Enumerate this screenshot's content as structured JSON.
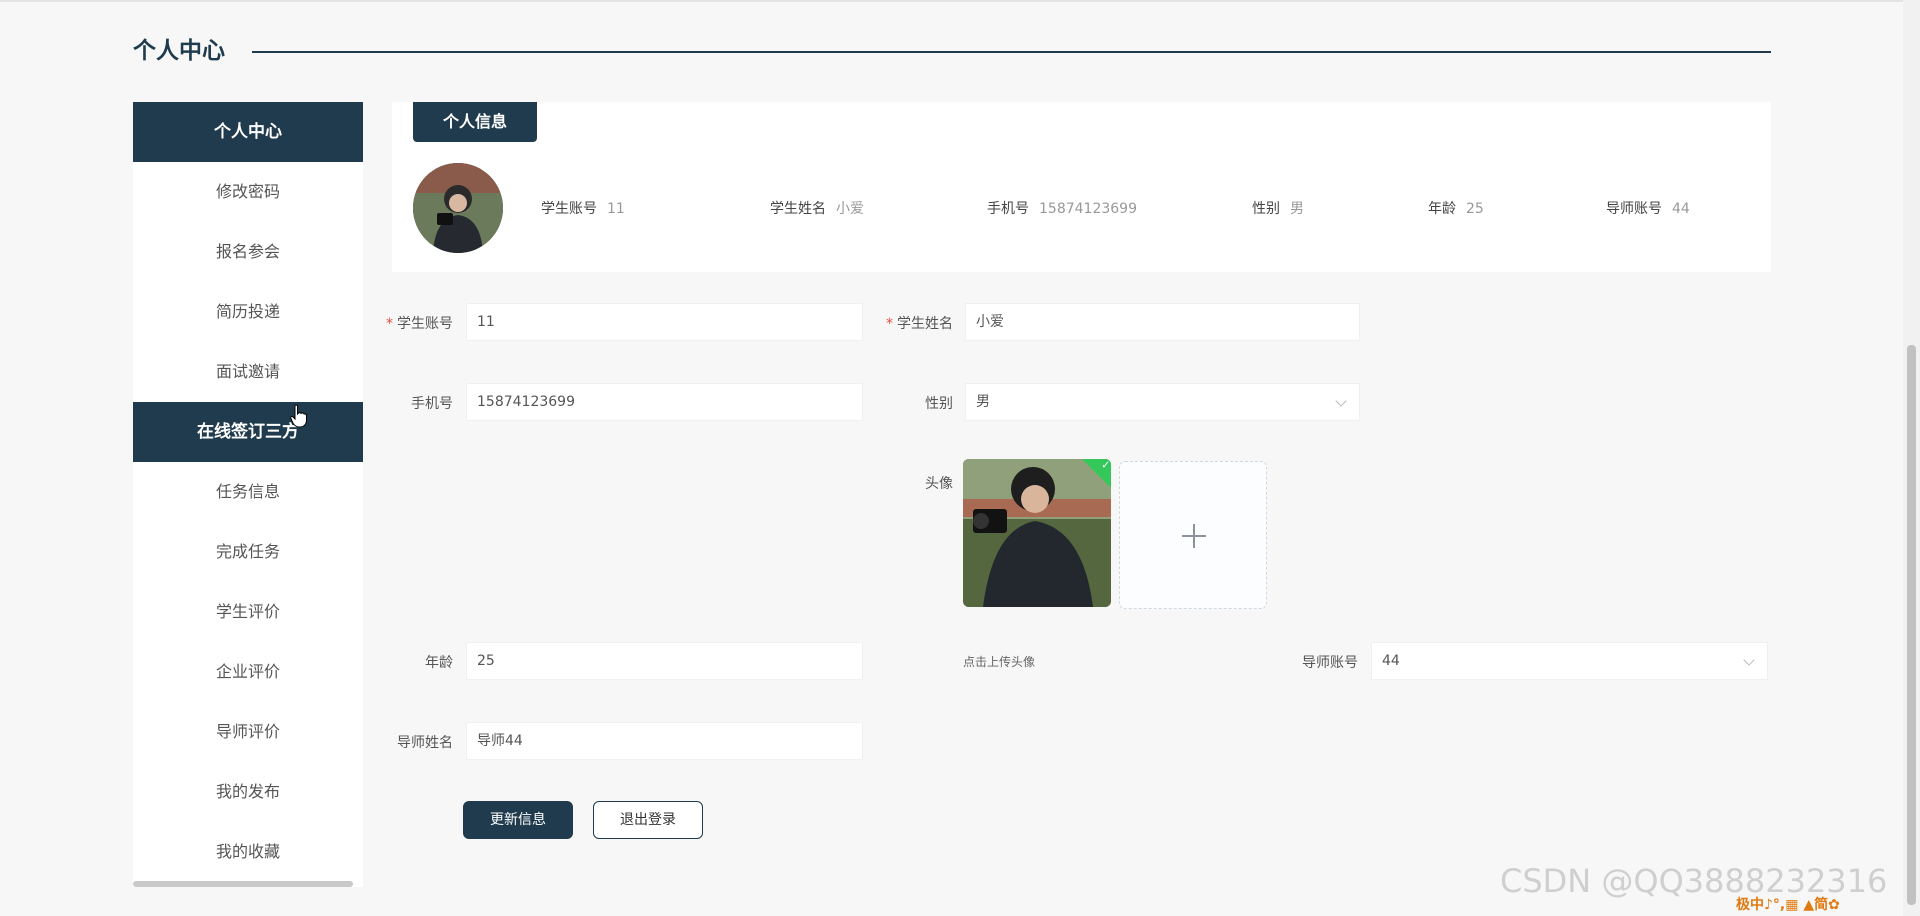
{
  "page": {
    "title": "个人中心"
  },
  "sidebar": {
    "items": [
      {
        "label": "个人中心"
      },
      {
        "label": "修改密码"
      },
      {
        "label": "报名参会"
      },
      {
        "label": "简历投递"
      },
      {
        "label": "面试邀请"
      },
      {
        "label": "在线签订三方"
      },
      {
        "label": "任务信息"
      },
      {
        "label": "完成任务"
      },
      {
        "label": "学生评价"
      },
      {
        "label": "企业评价"
      },
      {
        "label": "导师评价"
      },
      {
        "label": "我的发布"
      },
      {
        "label": "我的收藏"
      }
    ]
  },
  "card": {
    "tab_label": "个人信息",
    "summary": [
      {
        "label": "学生账号",
        "value": "11"
      },
      {
        "label": "学生姓名",
        "value": "小爱"
      },
      {
        "label": "手机号",
        "value": "15874123699"
      },
      {
        "label": "性别",
        "value": "男"
      },
      {
        "label": "年龄",
        "value": "25"
      },
      {
        "label": "导师账号",
        "value": "44"
      }
    ]
  },
  "form": {
    "student_account": {
      "label": "学生账号",
      "value": "11"
    },
    "student_name": {
      "label": "学生姓名",
      "value": "小爱"
    },
    "phone": {
      "label": "手机号",
      "value": "15874123699"
    },
    "gender": {
      "label": "性别",
      "value": "男"
    },
    "avatar": {
      "label": "头像",
      "hint": "点击上传头像"
    },
    "age": {
      "label": "年龄",
      "value": "25"
    },
    "mentor_account": {
      "label": "导师账号",
      "value": "44"
    },
    "mentor_name": {
      "label": "导师姓名",
      "value": "导师44"
    }
  },
  "buttons": {
    "update": "更新信息",
    "logout": "退出登录"
  },
  "watermark": "CSDN @QQ3888232316",
  "tray_text": "极中♪°,▦ ▲简✿",
  "colors": {
    "primary": "#1f3b4d",
    "required": "#e74c3c",
    "success": "#34c759"
  }
}
